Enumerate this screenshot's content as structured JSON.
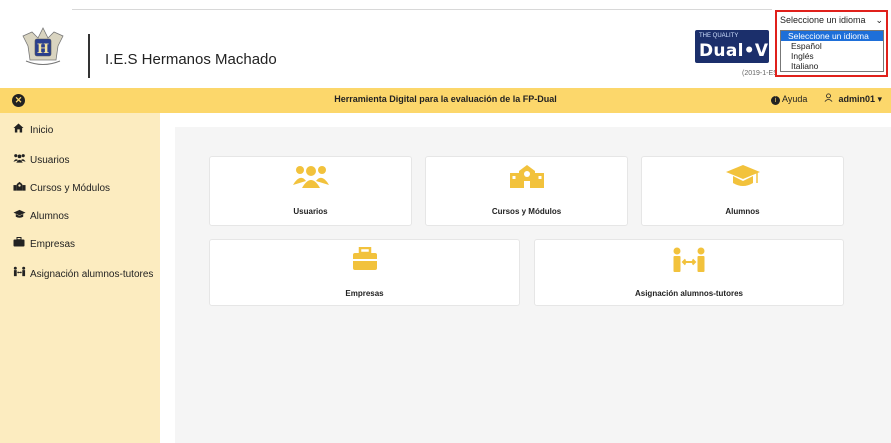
{
  "header": {
    "school_name": "I.E.S Hermanos Machado",
    "partner_logo_small": "THE QUALITY",
    "partner_logo_big": "Dual•VET",
    "partner_code": "(2019-1-ES01-KA202-064699)"
  },
  "language": {
    "selected": "Seleccione un idioma",
    "options": [
      "Seleccione un idioma",
      "Español",
      "Inglés",
      "Italiano"
    ]
  },
  "topbar": {
    "title": "Herramienta Digital para la evaluación de la FP-Dual",
    "help_label": "Ayuda",
    "user_label": "admin01",
    "accent_color": "#fcd76b"
  },
  "sidebar": {
    "items": [
      {
        "label": "Inicio",
        "icon": "home-icon"
      },
      {
        "label": "Usuarios",
        "icon": "users-icon"
      },
      {
        "label": "Cursos y Módulos",
        "icon": "school-icon"
      },
      {
        "label": "Alumnos",
        "icon": "graduation-cap-icon"
      },
      {
        "label": "Empresas",
        "icon": "briefcase-icon"
      },
      {
        "label": "Asignación alumnos-tutores",
        "icon": "user-exchange-icon"
      }
    ]
  },
  "cards": [
    {
      "label": "Usuarios",
      "icon": "users-icon"
    },
    {
      "label": "Cursos y Módulos",
      "icon": "school-icon"
    },
    {
      "label": "Alumnos",
      "icon": "graduation-cap-icon"
    },
    {
      "label": "Empresas",
      "icon": "briefcase-icon"
    },
    {
      "label": "Asignación alumnos-tutores",
      "icon": "user-exchange-icon"
    }
  ]
}
